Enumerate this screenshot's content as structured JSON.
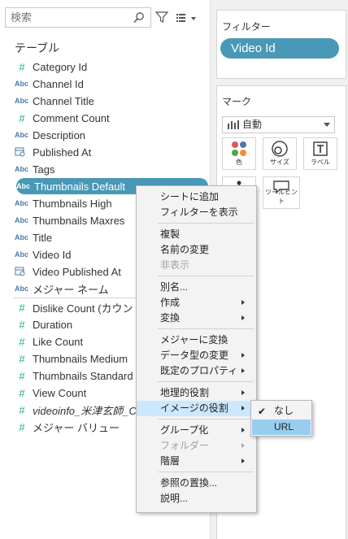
{
  "search": {
    "placeholder": "検索"
  },
  "tables_heading": "テーブル",
  "fields": [
    {
      "type": "#",
      "kind": "measure",
      "name": "Category Id"
    },
    {
      "type": "Abc",
      "kind": "string",
      "name": "Channel Id"
    },
    {
      "type": "Abc",
      "kind": "string",
      "name": "Channel Title"
    },
    {
      "type": "#",
      "kind": "measure",
      "name": "Comment Count"
    },
    {
      "type": "Abc",
      "kind": "string",
      "name": "Description"
    },
    {
      "type": "date",
      "kind": "date",
      "name": "Published At"
    },
    {
      "type": "Abc",
      "kind": "string",
      "name": "Tags"
    },
    {
      "type": "Abc",
      "kind": "string",
      "name": "Thumbnails Default",
      "selected": true
    },
    {
      "type": "Abc",
      "kind": "string",
      "name": "Thumbnails High"
    },
    {
      "type": "Abc",
      "kind": "string",
      "name": "Thumbnails Maxres"
    },
    {
      "type": "Abc",
      "kind": "string",
      "name": "Title"
    },
    {
      "type": "Abc",
      "kind": "string",
      "name": "Video Id"
    },
    {
      "type": "date",
      "kind": "date",
      "name": "Video Published At"
    },
    {
      "type": "Abc",
      "kind": "string",
      "name": "メジャー ネーム"
    },
    {
      "type": "#",
      "kind": "measure",
      "name": "Dislike Count (カウント)"
    },
    {
      "type": "#",
      "kind": "measure",
      "name": "Duration"
    },
    {
      "type": "#",
      "kind": "measure",
      "name": "Like Count"
    },
    {
      "type": "#",
      "kind": "measure",
      "name": "Thumbnails Medium"
    },
    {
      "type": "#",
      "kind": "measure",
      "name": "Thumbnails Standard"
    },
    {
      "type": "#",
      "kind": "measure",
      "name": "View Count"
    },
    {
      "type": "#",
      "kind": "measure",
      "name": "videoinfo_米津玄師_C",
      "italic": true
    },
    {
      "type": "#",
      "kind": "measure",
      "name": "メジャー バリュー"
    }
  ],
  "filters": {
    "title": "フィルター",
    "pill": "Video Id"
  },
  "marks": {
    "title": "マーク",
    "type_select": "自動",
    "buttons": {
      "color": "色",
      "size": "サイズ",
      "label": "ラベル",
      "tooltip": "ツールヒント"
    }
  },
  "context_menu": [
    {
      "label": "シートに追加"
    },
    {
      "label": "フィルターを表示"
    },
    {
      "sep": true
    },
    {
      "label": "複製"
    },
    {
      "label": "名前の変更"
    },
    {
      "label": "非表示",
      "disabled": true
    },
    {
      "sep": true
    },
    {
      "label": "別名..."
    },
    {
      "label": "作成",
      "submenu": true
    },
    {
      "label": "変換",
      "submenu": true
    },
    {
      "sep": true
    },
    {
      "label": "メジャーに変換"
    },
    {
      "label": "データ型の変更",
      "submenu": true
    },
    {
      "label": "既定のプロパティ",
      "submenu": true
    },
    {
      "sep": true
    },
    {
      "label": "地理的役割",
      "submenu": true
    },
    {
      "label": "イメージの役割",
      "submenu": true,
      "highlight": true
    },
    {
      "sep": true
    },
    {
      "label": "グループ化",
      "submenu": true
    },
    {
      "label": "フォルダー",
      "submenu": true,
      "disabled": true
    },
    {
      "label": "階層",
      "submenu": true
    },
    {
      "sep": true
    },
    {
      "label": "参照の置換..."
    },
    {
      "label": "説明..."
    }
  ],
  "submenu": [
    {
      "label": "なし",
      "checked": true
    },
    {
      "label": "URL",
      "highlight": true
    }
  ],
  "colors": {
    "accent": "#4a98b7",
    "menu_highlight": "#cce8ff",
    "submenu_highlight": "#99cdf0",
    "measure_icon": "#26a69a",
    "dimension_icon": "#4e79a7"
  }
}
